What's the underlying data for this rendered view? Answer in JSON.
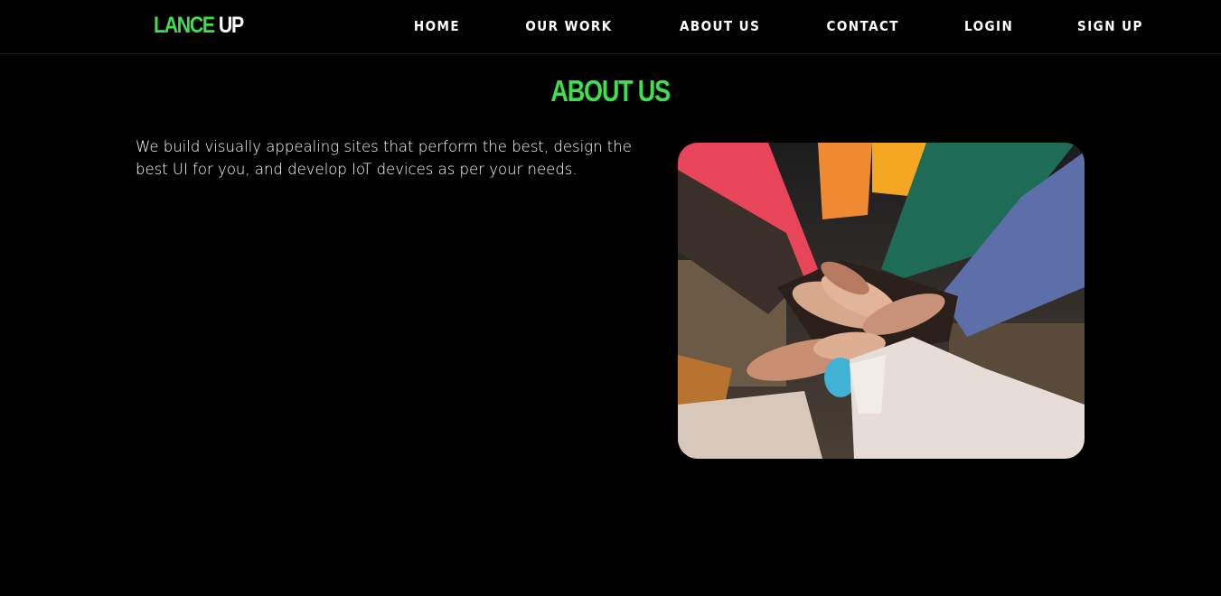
{
  "brand": {
    "part1": "LANCE",
    "part2": "UP"
  },
  "nav": {
    "items": [
      "HOME",
      "OUR WORK",
      "ABOUT US",
      "CONTACT",
      "LOGIN",
      "SIGN UP"
    ]
  },
  "about": {
    "title": "ABOUT US",
    "text": "We build visually appealing sites that perform the best, design the best UI for you, and develop IoT devices as per your needs."
  },
  "colors": {
    "accent": "#3fe04d",
    "background": "#000000",
    "text": "#ffffff"
  }
}
